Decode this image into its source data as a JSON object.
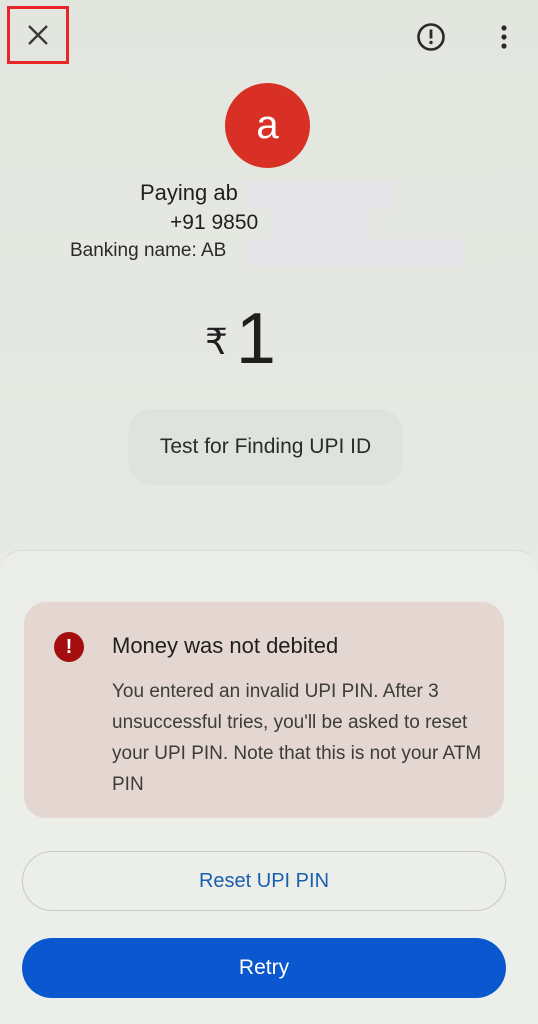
{
  "header": {
    "close_icon": "close-icon",
    "report_icon": "alert-circle-icon",
    "more_icon": "more-vert-icon"
  },
  "payee": {
    "avatar_letter": "a",
    "avatar_color": "#d93025",
    "name": "Paying ab",
    "phone": "+91 9850",
    "banking_name": "Banking name: AB"
  },
  "payment": {
    "currency": "₹",
    "amount": "1",
    "note": "Test for Finding UPI ID"
  },
  "error": {
    "icon": "error-icon",
    "title": "Money was not debited",
    "message": "You entered an invalid UPI PIN. After 3 unsuccessful tries, you'll be asked to reset your UPI PIN. Note that this is not your ATM PIN"
  },
  "actions": {
    "reset_label": "Reset UPI PIN",
    "retry_label": "Retry",
    "primary_color": "#0b57d0"
  }
}
